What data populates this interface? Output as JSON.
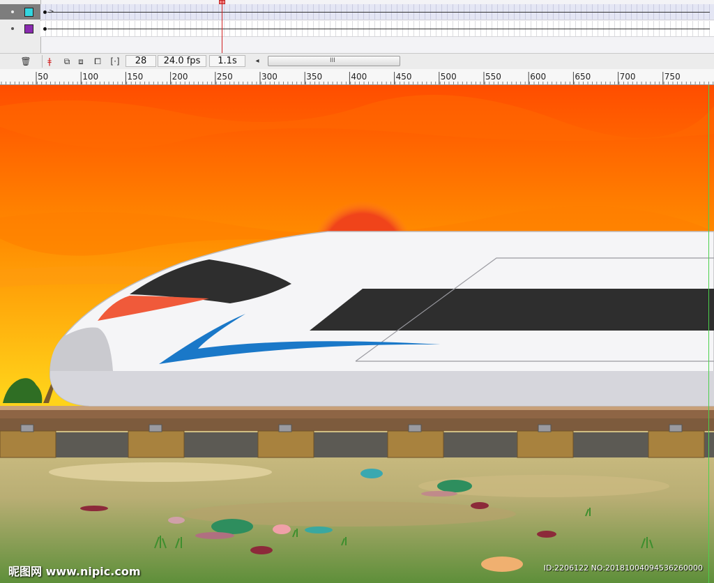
{
  "timeline": {
    "layers": [
      {
        "swatch_color": "#33d6e0",
        "selected": true
      },
      {
        "swatch_color": "#8a2bb0",
        "selected": false
      }
    ],
    "playhead_frame": 28
  },
  "statusbar": {
    "current_frame": "28",
    "frame_rate": "24.0 fps",
    "elapsed_time": "1.1s",
    "scroll_arrow": "◂",
    "scroll_grip": "III"
  },
  "ruler": {
    "ticks": [
      "50",
      "100",
      "150",
      "200",
      "250",
      "300",
      "350",
      "400",
      "450",
      "500",
      "550",
      "600",
      "650",
      "700",
      "750"
    ]
  },
  "stage": {
    "sky_colors": [
      "#ff4d00",
      "#ff8a00",
      "#ffd31a"
    ],
    "train_body_color": "#f5f5f7",
    "train_window_color": "#2e2e2e",
    "train_stripe_color": "#1a78c8",
    "sun_color": "#f0441a"
  },
  "watermark": {
    "logo_text": "昵图网 www.nipic.com",
    "id_text": "ID:2206122 NO:20181004094536260000"
  }
}
